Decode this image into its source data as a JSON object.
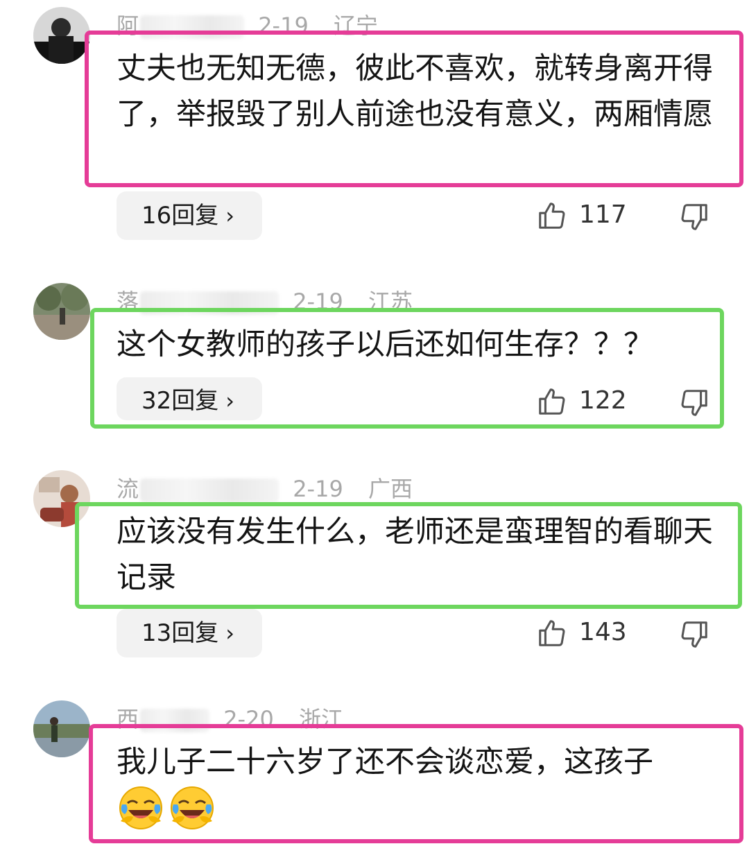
{
  "colors": {
    "pink_highlight": "#e53c97",
    "green_highlight": "#6dd65e",
    "meta_gray": "#a8a8a8",
    "reply_bg": "#f2f2f2"
  },
  "comments": [
    {
      "name": "阿",
      "date": "2-19",
      "location": "辽宁",
      "text": "丈夫也无知无德，彼此不喜欢，就转身离开得了，举报毁了别人前途也没有意义，两厢情愿",
      "replies_label": "16回复",
      "likes": "117",
      "highlight": "pink"
    },
    {
      "name": "落",
      "date": "2-19",
      "location": "江苏",
      "text": "这个女教师的孩子以后还如何生存？？？",
      "replies_label": "32回复",
      "likes": "122",
      "highlight": "green"
    },
    {
      "name": "流",
      "date": "2-19",
      "location": "广西",
      "text": "应该没有发生什么，老师还是蛮理智的看聊天记录",
      "replies_label": "13回复",
      "likes": "143",
      "highlight": "green"
    },
    {
      "name": "西",
      "date": "2-20",
      "location": "浙江",
      "text": "我儿子二十六岁了还不会谈恋爱，这孩子",
      "emoji_icons": [
        "laughing-crying-face-icon",
        "laughing-crying-face-icon"
      ],
      "highlight": "pink"
    }
  ]
}
